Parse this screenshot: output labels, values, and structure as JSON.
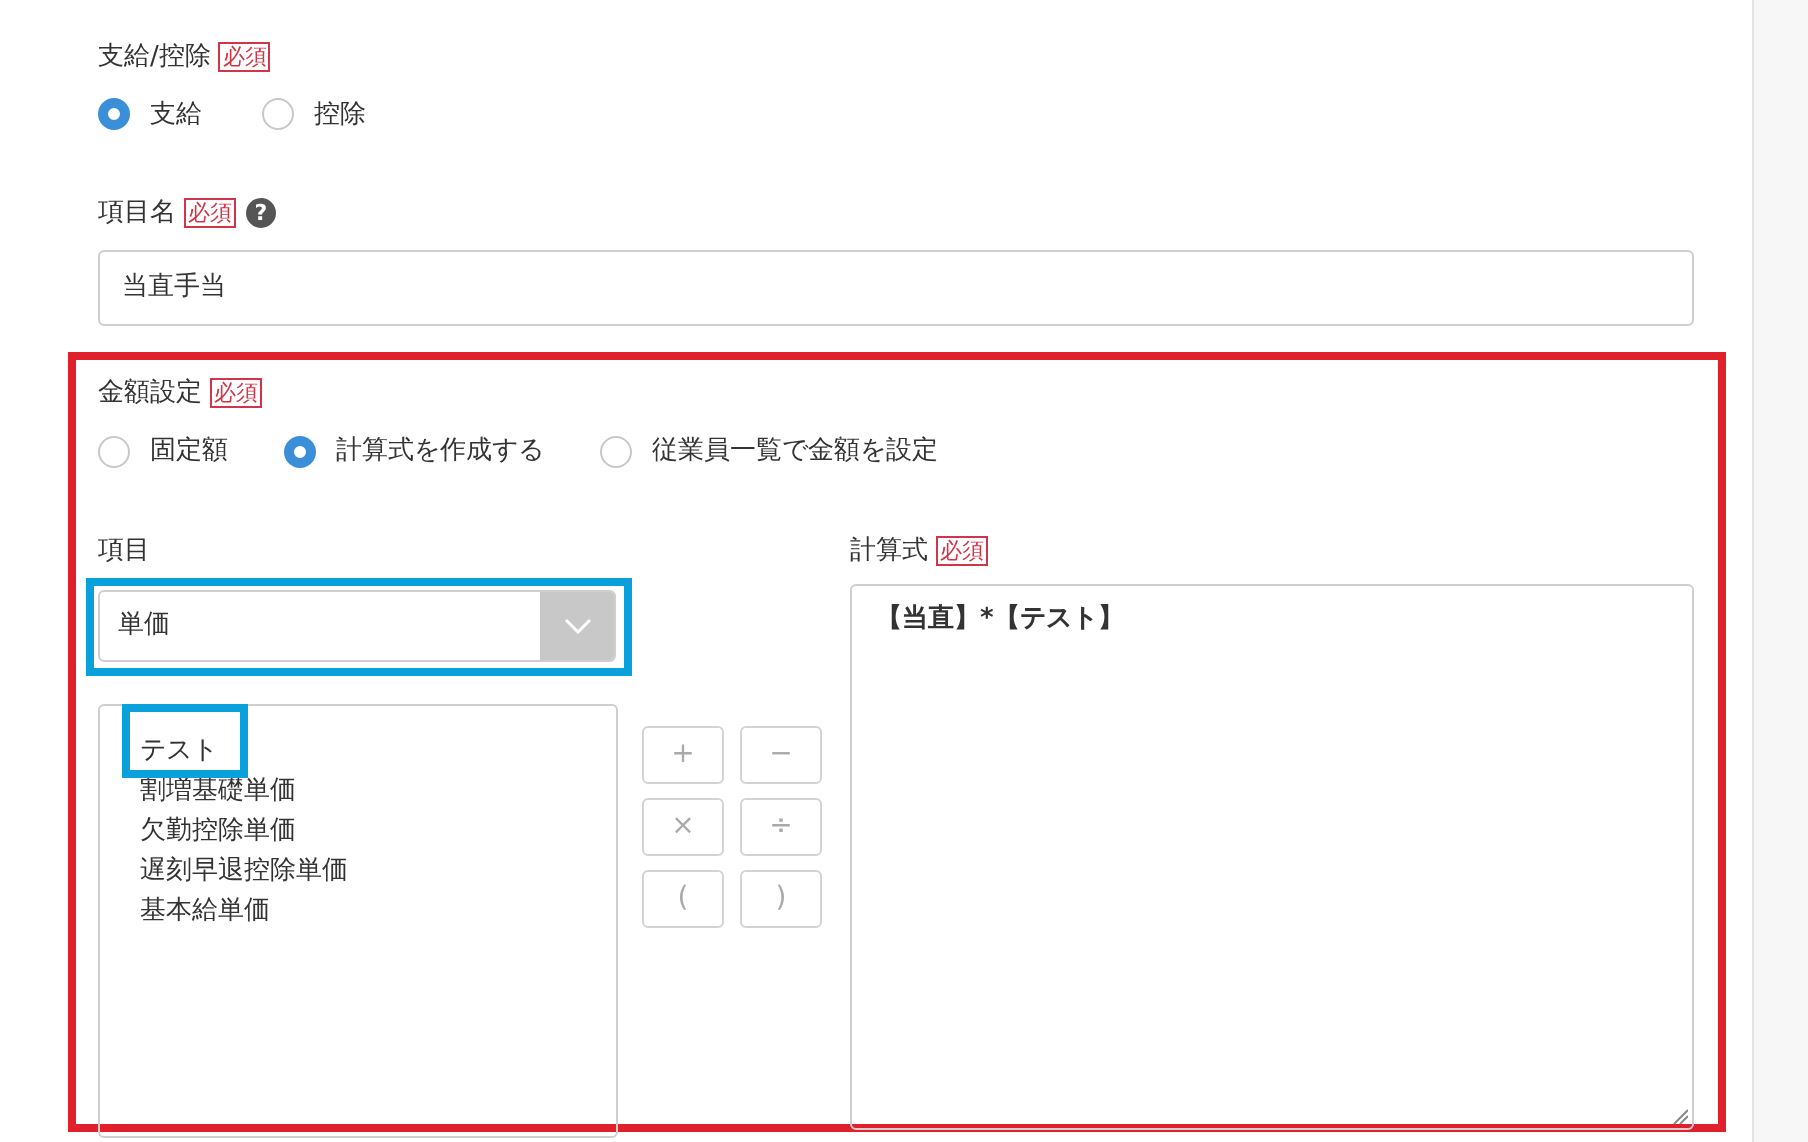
{
  "payment_type": {
    "label": "支給/控除",
    "required": "必須",
    "options": [
      {
        "label": "支給",
        "selected": true
      },
      {
        "label": "控除",
        "selected": false
      }
    ]
  },
  "item_name": {
    "label": "項目名",
    "required": "必須",
    "help": "?",
    "value": "当直手当"
  },
  "amount_setting": {
    "label": "金額設定",
    "required": "必須",
    "options": [
      {
        "label": "固定額",
        "selected": false
      },
      {
        "label": "計算式を作成する",
        "selected": true
      },
      {
        "label": "従業員一覧で金額を設定",
        "selected": false
      }
    ],
    "item": {
      "label": "項目",
      "select_value": "単価",
      "list": [
        "テスト",
        "割増基礎単価",
        "欠勤控除単価",
        "遅刻早退控除単価",
        "基本給単価"
      ]
    },
    "operators": [
      "+",
      "−",
      "×",
      "÷",
      "(",
      ")"
    ],
    "formula": {
      "label": "計算式",
      "required": "必須",
      "value": "【当直】*【テスト】"
    }
  }
}
